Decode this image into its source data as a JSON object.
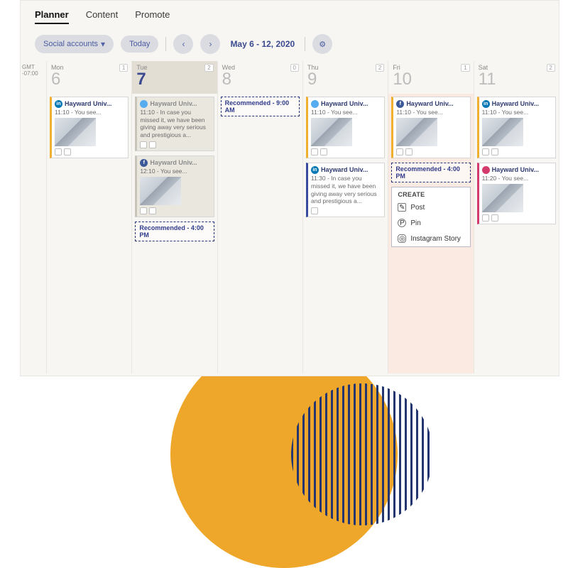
{
  "nav": {
    "planner": "Planner",
    "content": "Content",
    "promote": "Promote"
  },
  "toolbar": {
    "accounts": "Social accounts",
    "today": "Today",
    "range": "May 6 - 12, 2020"
  },
  "gmt": {
    "label": "GMT",
    "offset": "-07:00"
  },
  "days": [
    {
      "dow": "Mon",
      "num": "6",
      "count": "1"
    },
    {
      "dow": "Tue",
      "num": "7",
      "count": "2"
    },
    {
      "dow": "Wed",
      "num": "8",
      "count": "0"
    },
    {
      "dow": "Thu",
      "num": "9",
      "count": "2"
    },
    {
      "dow": "Fri",
      "num": "10",
      "count": "1"
    },
    {
      "dow": "Sat",
      "num": "11",
      "count": "2"
    }
  ],
  "cards": {
    "mon": {
      "title": "Hayward Univ...",
      "meta": "11:10 - You see..."
    },
    "tue1": {
      "title": "Hayward Univ...",
      "meta": "11:10 - In case you missed it, we have been giving away very serious and prestigious a..."
    },
    "tue2": {
      "title": "Hayward Univ...",
      "meta": "12:10 - You see..."
    },
    "tue_reco": "Recommended - 4:00 PM",
    "wed_reco": "Recommended - 9:00 AM",
    "thu1": {
      "title": "Hayward Univ...",
      "meta": "11:10 - You see..."
    },
    "thu2": {
      "title": "Hayward Univ...",
      "meta": "11:30 - In case you missed it, we have been giving away very serious and prestigious a..."
    },
    "fri1": {
      "title": "Hayward Univ...",
      "meta": "11:10 - You see..."
    },
    "fri_reco": "Recommended - 4:00 PM",
    "sat1": {
      "title": "Hayward Univ...",
      "meta": "11:10 - You see..."
    },
    "sat2": {
      "title": "Hayward Univ...",
      "meta": "11:20 - You see..."
    }
  },
  "popup": {
    "header": "CREATE",
    "opt1": "Post",
    "opt2": "Pin",
    "opt3": "Instagram Story"
  }
}
